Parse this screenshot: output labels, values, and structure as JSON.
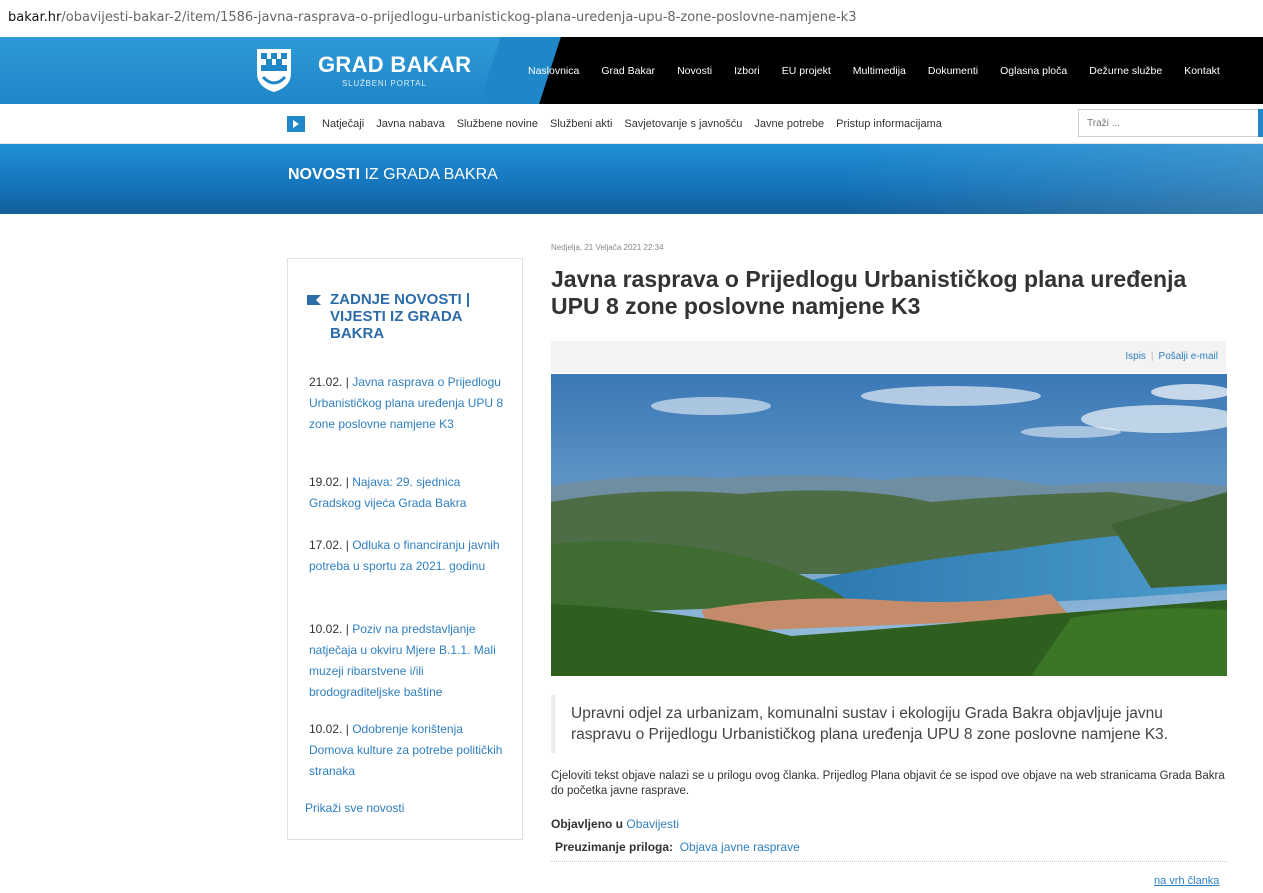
{
  "browser": {
    "url_domain": "bakar.hr",
    "url_path": "/obavijesti-bakar-2/item/1586-javna-rasprava-o-prijedlogu-urbanistickog-plana-uredenja-upu-8-zone-poslovne-namjene-k3"
  },
  "header": {
    "logo_title": "GRAD BAKAR",
    "logo_subtitle": "SLUŽBENI PORTAL",
    "nav": [
      "Naslovnica",
      "Grad Bakar",
      "Novosti",
      "Izbori",
      "EU projekt",
      "Multimedija",
      "Dokumenti",
      "Oglasna ploča",
      "Dežurne službe",
      "Kontakt"
    ]
  },
  "subnav": {
    "items": [
      "Natječaji",
      "Javna nabava",
      "Službene novine",
      "Službeni akti",
      "Savjetovanje s javnošću",
      "Javne potrebe",
      "Pristup informacijama"
    ],
    "search_placeholder": "Traži ..."
  },
  "banner": {
    "title_bold": "NOVOSTI",
    "title_rest": " IZ GRADA BAKRA"
  },
  "sidebar": {
    "heading": "ZADNJE NOVOSTI | VIJESTI IZ GRADA BAKRA",
    "news": [
      {
        "date": "21.02.",
        "title": "Javna rasprava o Prijedlogu Urbanističkog plana uređenja UPU 8 zone poslovne namjene K3"
      },
      {
        "date": "19.02.",
        "title": "Najava: 29. sjednica Gradskog vijeća Grada Bakra"
      },
      {
        "date": "17.02.",
        "title": "Odluka o financiranju javnih potreba u sportu za 2021. godinu"
      },
      {
        "date": "10.02.",
        "title": "Poziv na predstavljanje natječaja u okviru Mjere B.1.1. Mali muzeji ribarstvene i/ili brodograditeljske baštine"
      },
      {
        "date": "10.02.",
        "title": "Odobrenje korištenja Domova kulture za potrebe političkih stranaka"
      }
    ],
    "show_all": "Prikaži sve novosti"
  },
  "article": {
    "date": "Nedjelja, 21 Veljača 2021 22:34",
    "title": "Javna rasprava o Prijedlogu Urbanističkog plana uređenja UPU 8 zone poslovne namjene K3",
    "tools": {
      "print": "Ispis",
      "email": "Pošalji e-mail"
    },
    "lead": "Upravni odjel za urbanizam, komunalni sustav i ekologiju Grada Bakra objavljuje javnu raspravu o Prijedlogu Urbanističkog plana uređenja UPU 8 zone poslovne namjene K3.",
    "body": "Cjeloviti tekst objave nalazi se u prilogu ovog članka. Prijedlog Plana objavit će se ispod ove objave na web stranicama Grada Bakra do početka javne rasprave.",
    "published_label": "Objavljeno u",
    "published_category": "Obavijesti",
    "attachments_label": "Preuzimanje priloga:",
    "attachment_link": "Objava javne rasprave",
    "to_top": "na vrh članka"
  },
  "colors": {
    "brand_blue": "#1f86c8",
    "link_blue": "#2f7fc1",
    "heading_blue": "#2d6ca8",
    "top_bar_black": "#000000"
  }
}
